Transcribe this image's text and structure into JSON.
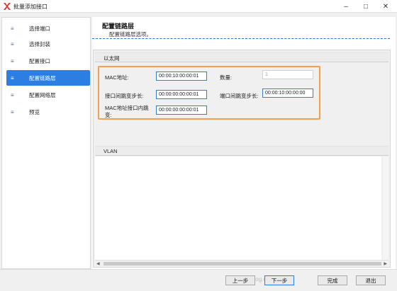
{
  "window": {
    "title": "批量添加接口",
    "minimize_label": "–",
    "maximize_label": "□",
    "close_label": "✕"
  },
  "sidebar": {
    "items": [
      {
        "label": "选择端口",
        "active": false
      },
      {
        "label": "选择封装",
        "active": false
      },
      {
        "label": "配置接口",
        "active": false
      },
      {
        "label": "配置链路层",
        "active": true
      },
      {
        "label": "配置网络层",
        "active": false
      },
      {
        "label": "预览",
        "active": false
      }
    ],
    "icon_glyph": "≡",
    "active_color": "#2c7ee2"
  },
  "page": {
    "title": "配置链路层",
    "subtitle": "配置链路层选项。"
  },
  "ethernet": {
    "section_label": "以太网",
    "mac_label": "MAC地址:",
    "mac_value": "00:00:10:00:00:01",
    "count_label": "数量:",
    "count_value": "1",
    "iface_step_label": "接口间跳变步长:",
    "iface_step_value": "00:00:00:00:00:01",
    "port_step_label": "端口间跳变步长:",
    "port_step_value": "00:00:10:00:00:00",
    "mac_iface_step_label_1": "MAC地址接口内跳",
    "mac_iface_step_label_2": "变:",
    "mac_iface_step_value": "00:00:00:00:00:01",
    "highlight_color": "#f0a050"
  },
  "vlan": {
    "section_label": "VLAN"
  },
  "footer": {
    "prev_label": "上一步",
    "next_label": "下一步",
    "finish_label": "完成",
    "exit_label": "退出",
    "watermark": "https://blog.csdn.net/..."
  }
}
